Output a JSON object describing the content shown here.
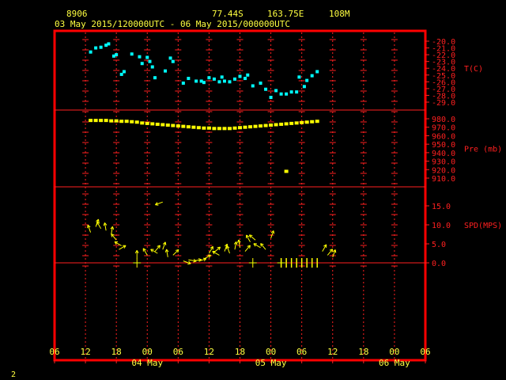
{
  "header": {
    "station": "8906",
    "lat": "77.44S",
    "lon": "163.75E",
    "elev": "108M",
    "period": "03 May 2015/120000UTC - 06 May 2015/000000UTC"
  },
  "footer": {
    "page_number": "2"
  },
  "colors": {
    "frame": "#ff0000",
    "grid": "#ff2020",
    "text": "#ffff40",
    "temp": "#00ffff",
    "pres": "#ffff00",
    "wind": "#ffff00"
  },
  "chart_data": {
    "type": "scatter",
    "x_axis": {
      "unit": "hours since 03 May 2015 06 UTC",
      "range": [
        0,
        72
      ],
      "tick_hours": [
        0,
        6,
        12,
        18,
        24,
        30,
        36,
        42,
        48,
        54,
        60,
        66,
        72
      ],
      "tick_labels": [
        "06",
        "12",
        "18",
        "00",
        "06",
        "12",
        "18",
        "00",
        "06",
        "12",
        "18",
        "00",
        "06"
      ],
      "day_labels": [
        {
          "label": "04 May",
          "at_hour": 18
        },
        {
          "label": "05 May",
          "at_hour": 42
        },
        {
          "label": "06 May",
          "at_hour": 66
        }
      ]
    },
    "panels": [
      {
        "id": "temperature",
        "label": "T(C)",
        "ticks": [
          "-20.0",
          "-21.0",
          "-22.0",
          "-23.0",
          "-24.0",
          "-25.0",
          "-26.0",
          "-27.0",
          "-28.0",
          "-29.0"
        ],
        "ylim": [
          -29,
          -20
        ],
        "series": [
          {
            "type": "scatter",
            "values": [
              [
                7,
                -21.6
              ],
              [
                8,
                -21.0
              ],
              [
                9,
                -20.9
              ],
              [
                10,
                -20.6
              ],
              [
                10.5,
                -20.4
              ],
              [
                11.5,
                -22.2
              ],
              [
                12,
                -22.0
              ],
              [
                13,
                -24.9
              ],
              [
                13.5,
                -24.5
              ],
              [
                15,
                -21.9
              ],
              [
                16.5,
                -22.3
              ],
              [
                17,
                -23.3
              ],
              [
                18,
                -22.4
              ],
              [
                18.5,
                -23.0
              ],
              [
                19,
                -23.8
              ],
              [
                19.5,
                -25.4
              ],
              [
                21.5,
                -24.4
              ],
              [
                22.5,
                -22.5
              ],
              [
                23,
                -23.0
              ],
              [
                25,
                -26.2
              ],
              [
                26,
                -25.5
              ],
              [
                27.5,
                -25.9
              ],
              [
                28.5,
                -25.9
              ],
              [
                29,
                -26.1
              ],
              [
                30,
                -25.4
              ],
              [
                31,
                -25.6
              ],
              [
                32,
                -26.0
              ],
              [
                32.5,
                -25.3
              ],
              [
                33,
                -25.9
              ],
              [
                34,
                -26.0
              ],
              [
                35,
                -25.6
              ],
              [
                36,
                -25.2
              ],
              [
                37,
                -25.5
              ],
              [
                37.5,
                -25.0
              ],
              [
                38.5,
                -26.6
              ],
              [
                40,
                -26.2
              ],
              [
                41,
                -27.1
              ],
              [
                42,
                -28.3
              ],
              [
                43,
                -27.3
              ],
              [
                44,
                -27.8
              ],
              [
                45,
                -27.8
              ],
              [
                46,
                -27.5
              ],
              [
                47,
                -27.5
              ],
              [
                47.5,
                -25.3
              ],
              [
                48.5,
                -26.7
              ],
              [
                49,
                -25.8
              ],
              [
                50,
                -25.1
              ],
              [
                51,
                -24.5
              ]
            ]
          }
        ]
      },
      {
        "id": "pressure",
        "label": "Pre (mb)",
        "ticks": [
          "980.0",
          "970.0",
          "960.0",
          "950.0",
          "940.0",
          "930.0",
          "920.0",
          "910.0"
        ],
        "ylim": [
          910,
          980
        ],
        "series": [
          {
            "type": "scatter",
            "values": [
              [
                7,
                978.0
              ],
              [
                8,
                978.0
              ],
              [
                9,
                978.0
              ],
              [
                10,
                978.0
              ],
              [
                11,
                977.5
              ],
              [
                12,
                977.5
              ],
              [
                13,
                977.0
              ],
              [
                14,
                977.0
              ],
              [
                15,
                976.5
              ],
              [
                16,
                976.0
              ],
              [
                17,
                975.0
              ],
              [
                18,
                974.5
              ],
              [
                19,
                974.0
              ],
              [
                20,
                973.5
              ],
              [
                21,
                973.0
              ],
              [
                22,
                972.5
              ],
              [
                23,
                972.0
              ],
              [
                24,
                971.5
              ],
              [
                25,
                971.0
              ],
              [
                26,
                970.5
              ],
              [
                27,
                970.0
              ],
              [
                28,
                969.5
              ],
              [
                29,
                969.0
              ],
              [
                30,
                969.0
              ],
              [
                31,
                968.5
              ],
              [
                32,
                968.5
              ],
              [
                33,
                968.5
              ],
              [
                34,
                968.5
              ],
              [
                35,
                969.0
              ],
              [
                36,
                969.5
              ],
              [
                37,
                970.0
              ],
              [
                38,
                970.5
              ],
              [
                39,
                971.0
              ],
              [
                40,
                971.5
              ],
              [
                41,
                972.0
              ],
              [
                42,
                972.5
              ],
              [
                43,
                973.0
              ],
              [
                44,
                973.5
              ],
              [
                45,
                974.0
              ],
              [
                46,
                974.5
              ],
              [
                47,
                975.0
              ],
              [
                48,
                975.5
              ],
              [
                49,
                976.0
              ],
              [
                50,
                976.5
              ],
              [
                51,
                977.0
              ],
              [
                45,
                918.0
              ]
            ]
          }
        ]
      },
      {
        "id": "wind_speed",
        "label": "SPD(MPS)",
        "ticks": [
          "15.0",
          "10.0",
          "5.0",
          "0.0"
        ],
        "ylim": [
          0,
          15
        ],
        "series": [
          {
            "type": "wind_arrows",
            "values": [
              [
                7,
                8.0,
                340
              ],
              [
                8,
                9.5,
                20
              ],
              [
                9,
                9.0,
                330
              ],
              [
                10,
                8.5,
                350
              ],
              [
                11,
                7.5,
                10
              ],
              [
                12,
                6.0,
                320
              ],
              [
                13,
                4.5,
                300
              ],
              [
                12.5,
                3.5,
                60
              ],
              [
                16,
                1.2,
                0
              ],
              [
                18,
                2.0,
                330
              ],
              [
                19.5,
                3.0,
                40
              ],
              [
                20,
                2.5,
                300
              ],
              [
                21,
                3.5,
                20
              ],
              [
                22,
                1.5,
                350
              ],
              [
                23,
                2.0,
                45
              ],
              [
                25,
                0.5,
                110
              ],
              [
                26,
                0.8,
                100
              ],
              [
                27,
                0.5,
                80
              ],
              [
                28,
                0.4,
                70
              ],
              [
                29,
                1.0,
                60
              ],
              [
                30,
                2.5,
                30
              ],
              [
                31,
                2.8,
                50
              ],
              [
                32,
                2.0,
                300
              ],
              [
                33,
                3.0,
                20
              ],
              [
                34,
                2.5,
                340
              ],
              [
                35,
                3.5,
                10
              ],
              [
                36,
                4.0,
                350
              ],
              [
                37,
                3.0,
                40
              ],
              [
                38,
                5.5,
                330
              ],
              [
                39,
                6.0,
                310
              ],
              [
                40,
                4.0,
                300
              ],
              [
                41,
                3.5,
                320
              ],
              [
                42,
                6.5,
                20
              ],
              [
                44,
                0.0,
                0
              ],
              [
                45,
                0.0,
                0
              ],
              [
                46,
                0.0,
                0
              ],
              [
                47,
                0.0,
                0
              ],
              [
                48,
                0.0,
                0
              ],
              [
                49,
                0.0,
                0
              ],
              [
                50,
                0.0,
                0
              ],
              [
                51,
                0.0,
                0
              ],
              [
                52,
                3.0,
                30
              ],
              [
                53,
                2.0,
                40
              ],
              [
                54,
                1.5,
                20
              ],
              [
                21,
                16.0,
                250
              ]
            ]
          }
        ]
      }
    ]
  }
}
